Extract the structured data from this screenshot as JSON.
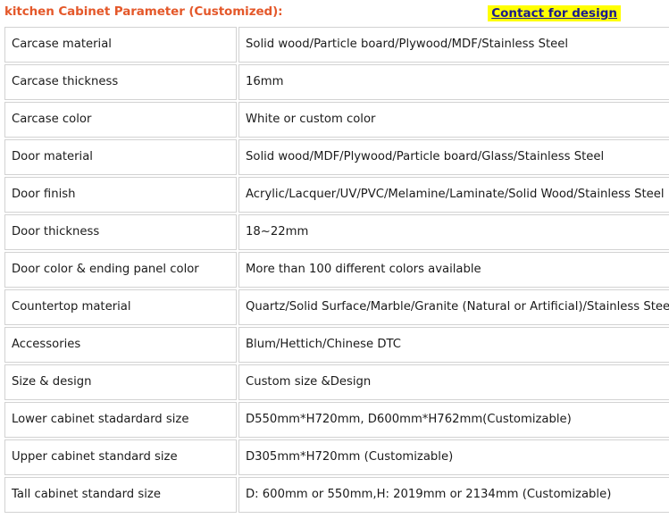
{
  "header": {
    "title": "kitchen Cabinet Parameter (Customized):",
    "link_label": "Contact for design",
    "title_color": "#e4582a",
    "link_color": "#1a1a8c",
    "link_highlight_color": "#ffff00"
  },
  "table": {
    "rows": [
      {
        "name": "Carcase material",
        "value": "Solid wood/Particle board/Plywood/MDF/Stainless Steel"
      },
      {
        "name": "Carcase thickness",
        "value": "16mm"
      },
      {
        "name": "Carcase color",
        "value": "White or custom color"
      },
      {
        "name": "Door material",
        "value": "Solid wood/MDF/Plywood/Particle board/Glass/Stainless Steel"
      },
      {
        "name": "Door finish",
        "value": "Acrylic/Lacquer/UV/PVC/Melamine/Laminate/Solid Wood/Stainless Steel"
      },
      {
        "name": "Door thickness",
        "value": "18~22mm"
      },
      {
        "name": "Door color & ending panel color",
        "value": "More than 100 different colors available"
      },
      {
        "name": "Countertop material",
        "value": "Quartz/Solid Surface/Marble/Granite (Natural or Artificial)/Stainless Steel"
      },
      {
        "name": "Accessories",
        "value": "Blum/Hettich/Chinese DTC"
      },
      {
        "name": "Size & design",
        "value": "Custom size &Design"
      },
      {
        "name": "Lower cabinet stadardard size",
        "value": "D550mm*H720mm, D600mm*H762mm(Customizable)"
      },
      {
        "name": "Upper cabinet standard size",
        "value": "D305mm*H720mm (Customizable)"
      },
      {
        "name": "Tall cabinet standard size",
        "value": "D: 600mm or 550mm,H: 2019mm or 2134mm (Customizable)"
      }
    ]
  }
}
